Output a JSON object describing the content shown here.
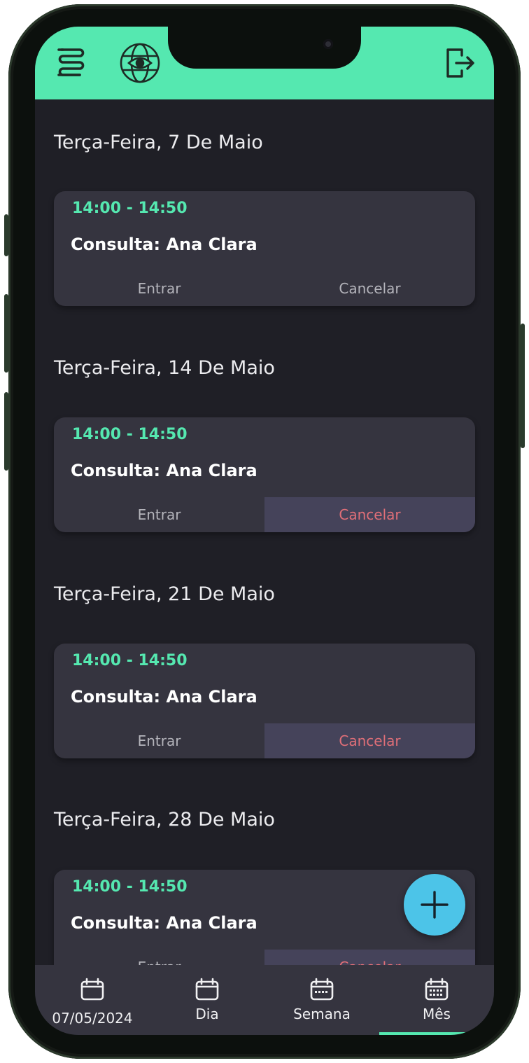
{
  "header": {
    "menu_icon": "menu-icon",
    "logo_icon": "eye-globe-logo-icon",
    "logout_icon": "logout-icon",
    "accent_color": "#55e8b0"
  },
  "agenda": [
    {
      "heading": "Terça-Feira, 7 De Maio",
      "time": "14:00 - 14:50",
      "title": "Consulta: Ana Clara",
      "enter_label": "Entrar",
      "cancel_label": "Cancelar"
    },
    {
      "heading": "Terça-Feira, 14 De Maio",
      "time": "14:00 - 14:50",
      "title": "Consulta: Ana Clara",
      "enter_label": "Entrar",
      "cancel_label": "Cancelar"
    },
    {
      "heading": "Terça-Feira, 21 De Maio",
      "time": "14:00 - 14:50",
      "title": "Consulta: Ana Clara",
      "enter_label": "Entrar",
      "cancel_label": "Cancelar"
    },
    {
      "heading": "Terça-Feira, 28 De Maio",
      "time": "14:00 - 14:50",
      "title": "Consulta: Ana Clara",
      "enter_label": "Entrar",
      "cancel_label": "Cancelar"
    }
  ],
  "fab": {
    "icon": "plus-icon"
  },
  "bottom_nav": {
    "date_label": "07/05/2024",
    "day_label": "Dia",
    "week_label": "Semana",
    "month_label": "Mês",
    "active": "Mês"
  }
}
